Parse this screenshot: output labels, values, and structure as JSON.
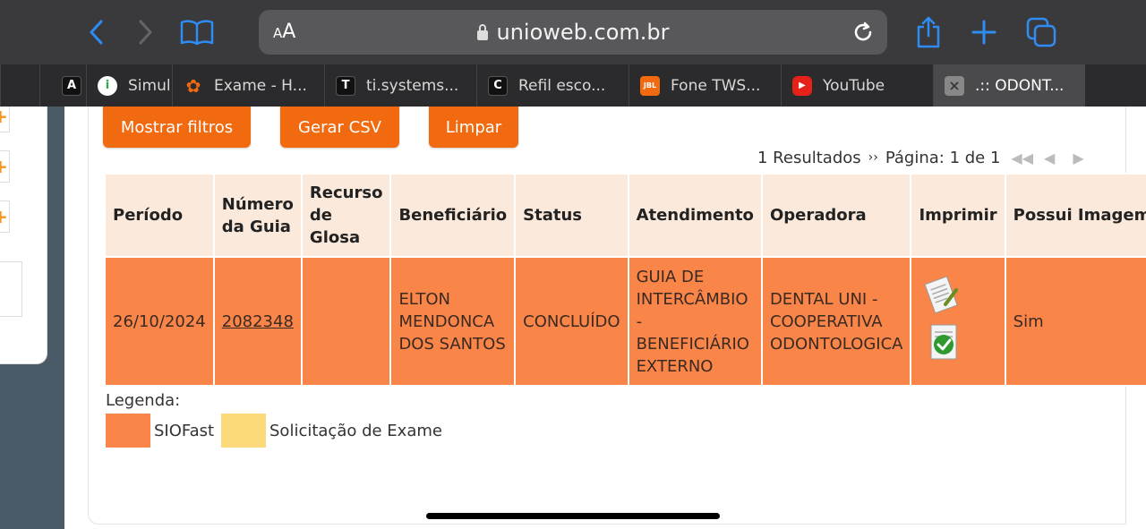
{
  "browser": {
    "aa_label": "AA",
    "url": "unioweb.com.br",
    "tabs": [
      {
        "label": "",
        "icon_letter": "A"
      },
      {
        "label": "Simul",
        "icon_letter": "i"
      },
      {
        "label": "Exame - H...",
        "icon_letter": "✿"
      },
      {
        "label": "ti.systems...",
        "icon_letter": "T"
      },
      {
        "label": "Refil esco...",
        "icon_letter": "C"
      },
      {
        "label": "Fone TWS...",
        "icon_letter": "JBL"
      },
      {
        "label": "YouTube",
        "icon_letter": "▶"
      },
      {
        "label": ".:: ODONT...",
        "icon_letter": "×"
      }
    ]
  },
  "actions": {
    "show_filters": "Mostrar filtros",
    "export_csv": "Gerar CSV",
    "clear": "Limpar"
  },
  "pager": {
    "results": "1 Resultados",
    "page_label": "Página: 1 de 1"
  },
  "table": {
    "headers": {
      "periodo": "Período",
      "numero_guia": "Número da Guia",
      "recurso_glosa": "Recurso de Glosa",
      "beneficiario": "Beneficiário",
      "status": "Status",
      "atendimento": "Atendimento",
      "operadora": "Operadora",
      "imprimir": "Imprimir",
      "possui_imagem": "Possui Imagem"
    },
    "rows": [
      {
        "periodo": "26/10/2024",
        "numero_guia": "2082348",
        "recurso_glosa": "",
        "beneficiario": "ELTON MENDONCA DOS SANTOS",
        "status": "CONCLUÍDO",
        "atendimento": "GUIA DE INTERCÂMBIO - BENEFICIÁRIO EXTERNO",
        "operadora": "DENTAL UNI - COOPERATIVA ODONTOLOGICA",
        "possui_imagem": "Sim"
      }
    ]
  },
  "legend": {
    "label": "Legenda:",
    "items": [
      {
        "label": "SIOFast",
        "color": "#fa8548"
      },
      {
        "label": "Solicitação de Exame",
        "color": "#fcd97a"
      }
    ]
  },
  "colors": {
    "accent": "#f26a10",
    "row_siofast": "#fa8548",
    "row_exame": "#fcd97a",
    "header_bg": "#fbeadc",
    "browser_blue": "#2f8cf2"
  }
}
